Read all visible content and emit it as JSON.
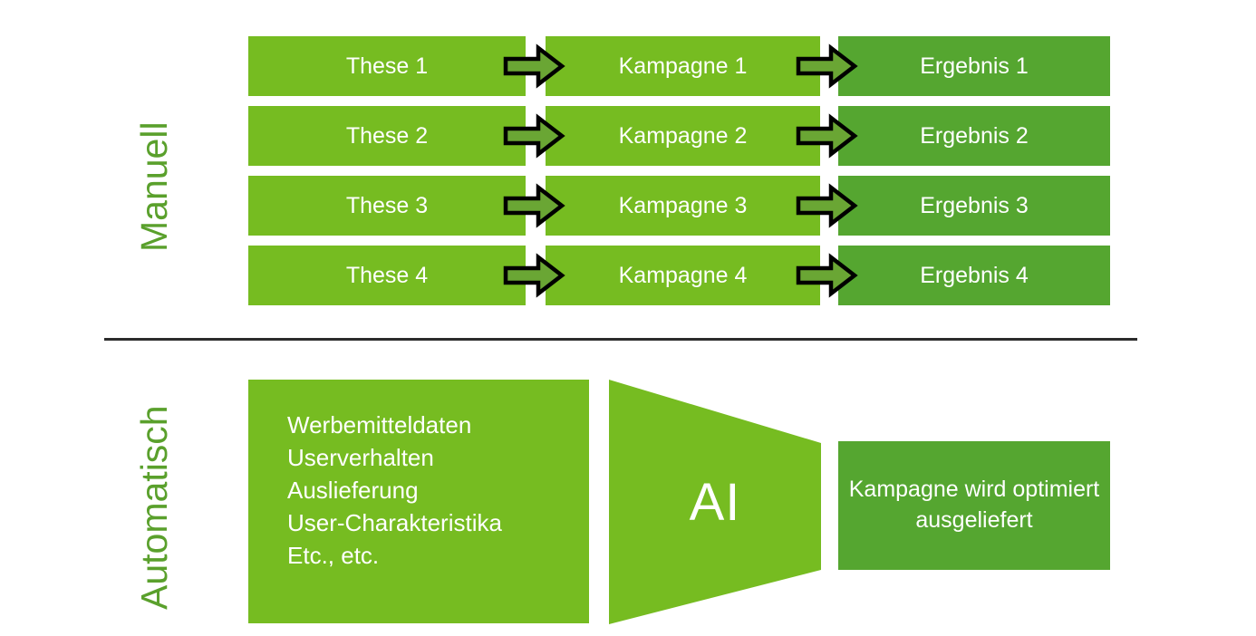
{
  "colors": {
    "light_green": "#76bc21",
    "dark_green": "#55a630",
    "label_green": "#5aa02c",
    "arrow_outline": "#000000",
    "arrow_fill": "#6aa634",
    "divider": "#2b2b2b",
    "text_on_green": "#ffffff",
    "background": "#ffffff"
  },
  "sections": {
    "manual": {
      "label": "Manuell",
      "columns": [
        "These",
        "Kampagne",
        "Ergebnis"
      ],
      "rows": [
        {
          "these": "These 1",
          "kampagne": "Kampagne 1",
          "ergebnis": "Ergebnis 1"
        },
        {
          "these": "These 2",
          "kampagne": "Kampagne 2",
          "ergebnis": "Ergebnis 2"
        },
        {
          "these": "These 3",
          "kampagne": "Kampagne 3",
          "ergebnis": "Ergebnis 3"
        },
        {
          "these": "These 4",
          "kampagne": "Kampagne 4",
          "ergebnis": "Ergebnis 4"
        }
      ],
      "arrow_icon": "right-block-arrow-icon"
    },
    "automatic": {
      "label": "Automatisch",
      "input_items": [
        "Werbemitteldaten",
        "Userverhalten",
        "Auslieferung",
        "User-Charakteristika",
        "Etc., etc."
      ],
      "input_text": "Werbemitteldaten\nUserverhalten\nAuslieferung\nUser-Charakteristika\nEtc., etc.",
      "funnel_label": "AI",
      "output_text": "Kampagne wird optimiert ausgeliefert",
      "output_line1": "Kampagne wird",
      "output_line2": "optimiert ausgeliefert"
    }
  }
}
